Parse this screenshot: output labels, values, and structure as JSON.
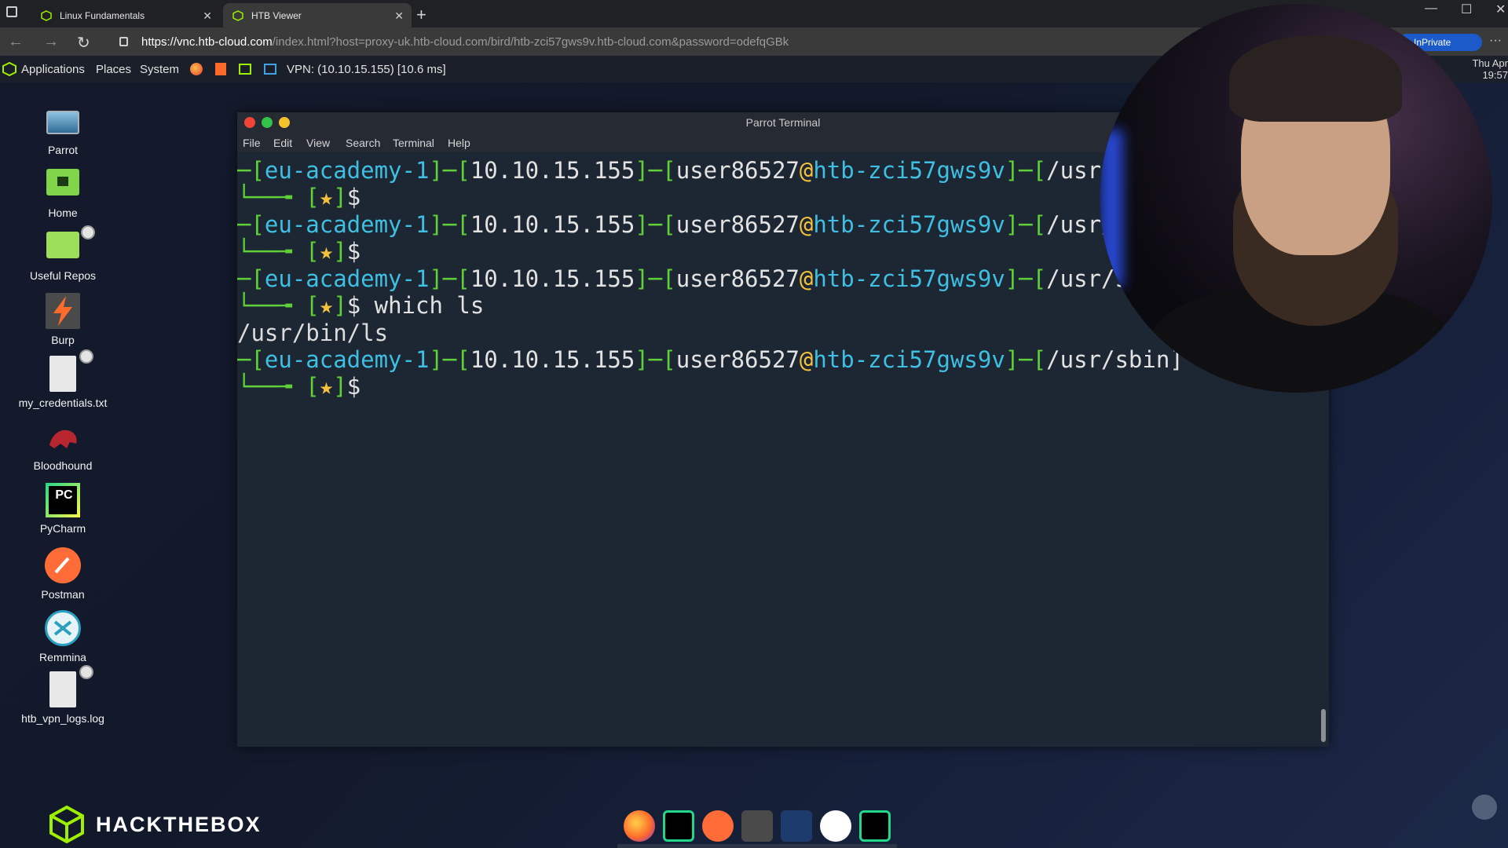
{
  "browser": {
    "tabs": [
      {
        "label": "Linux Fundamentals",
        "close": "✕"
      },
      {
        "label": "HTB Viewer",
        "close": "✕"
      }
    ],
    "new_tab": "+",
    "window_controls": {
      "minimize": "—",
      "maximize": "☐",
      "close": "✕"
    },
    "nav": {
      "back": "←",
      "forward": "→",
      "reload": "↻"
    },
    "url": {
      "scheme": "https://",
      "host": "vnc.htb-cloud.com",
      "rest": "/index.html?host=proxy-uk.htb-cloud.com/bird/htb-zci57gws9v.htb-cloud.com&password=odefqGBk"
    },
    "inprivate": "InPrivate",
    "more": "···"
  },
  "panel": {
    "applications": "Applications",
    "places": "Places",
    "system": "System",
    "vpn": "VPN: (10.10.15.155) [10.6 ms]",
    "clock_day": "Thu Apr",
    "clock_time": "19:57"
  },
  "desktop_icons": [
    {
      "label": "Parrot",
      "icon": "monitor-icon"
    },
    {
      "label": "Home",
      "icon": "home-folder-icon"
    },
    {
      "label": "Useful Repos",
      "icon": "folder-link-icon"
    },
    {
      "label": "Burp",
      "icon": "burp-icon"
    },
    {
      "label": "my_credentials.txt",
      "icon": "text-file-icon"
    },
    {
      "label": "Bloodhound",
      "icon": "bloodhound-icon"
    },
    {
      "label": "PyCharm",
      "icon": "pycharm-icon"
    },
    {
      "label": "Postman",
      "icon": "postman-icon"
    },
    {
      "label": "Remmina",
      "icon": "remmina-icon"
    },
    {
      "label": "htb_vpn_logs.log",
      "icon": "log-file-icon"
    }
  ],
  "terminal": {
    "title": "Parrot Terminal",
    "menu": [
      "File",
      "Edit",
      "View",
      "Search",
      "Terminal",
      "Help"
    ],
    "prompt": {
      "host_tag": "eu-academy-1",
      "ip": "10.10.15.155",
      "user": "user86527",
      "at": "@",
      "host": "htb-zci57gws9v",
      "star": "★",
      "dollar": "$"
    },
    "paths_visible": [
      "/usr/",
      "/usr/",
      "/usr/sb",
      "/usr/sbin]"
    ],
    "command": " which ls",
    "output": "/usr/bin/ls"
  },
  "logo": {
    "text": "HACKTHEBOX"
  },
  "dock": [
    "firefox-icon",
    "pycharm-icon",
    "postman-icon",
    "burp-icon",
    "metasploit-icon",
    "parrot-icon",
    "pycharm-icon"
  ],
  "colors": {
    "prompt_green": "#5fd038",
    "prompt_cyan": "#3fbfe2",
    "star_yellow": "#f3c13d",
    "htb_green": "#9fef00",
    "terminal_bg": "#1d2633"
  }
}
